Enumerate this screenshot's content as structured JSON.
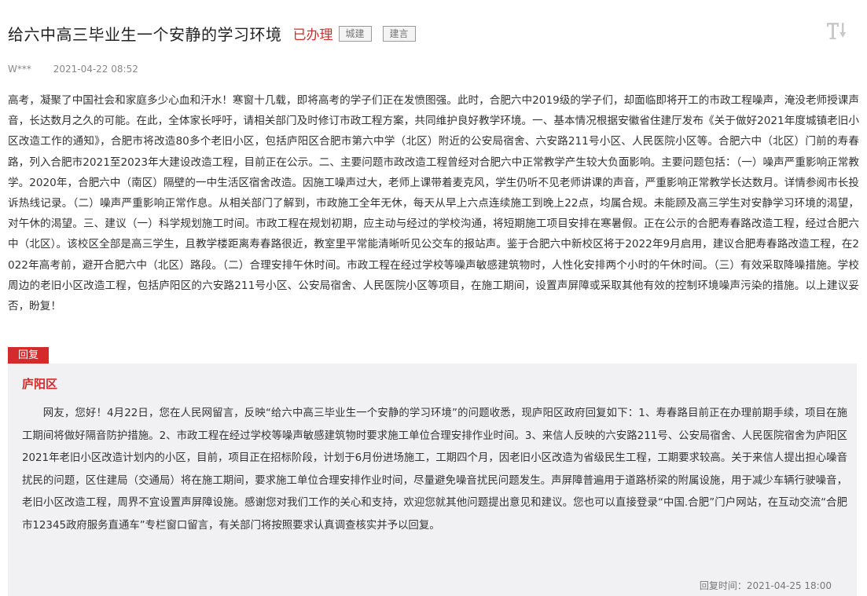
{
  "header": {
    "title": "给六中高三毕业生一个安静的学习环境",
    "status": "已办理",
    "tags": [
      "城建",
      "建言"
    ],
    "font_size_icon": "text-size-icon"
  },
  "meta": {
    "author": "W***",
    "date": "2021-04-22 08:52"
  },
  "body": {
    "text": "高考，凝聚了中国社会和家庭多少心血和汗水！寒窗十几载，即将高考的学子们正在发愤图强。此时，合肥六中2019级的学子们，却面临即将开工的市政工程噪声，淹没老师授课声音，长达数月之久的可能。在此，全体家长呼吁，请相关部门及时修订市政工程方案，共同维护良好教学环境。一、基本情况根据安徽省住建厅发布《关于做好2021年度城镇老旧小区改造工作的通知》，合肥市将改造80多个老旧小区，包括庐阳区合肥市第六中学（北区）附近的公安局宿舍、六安路211号小区、人民医院小区等。合肥六中（北区）门前的寿春路，列入合肥市2021至2023年大建设改造工程，目前正在公示。二、主要问题市政改造工程曾经对合肥六中正常教学产生较大负面影响。主要问题包括：（一）噪声严重影响正常教学。2020年，合肥六中（南区）隔壁的一中生活区宿舍改造。因施工噪声过大，老师上课带着麦克风，学生仍听不见老师讲课的声音，严重影响正常教学长达数月。详情参阅市长投诉热线记录。（二）噪声严重影响正常作息。从相关部门了解到，市政施工全年无休，每天从早上六点连续施工到晚上22点，均属合规。未能顾及高三学生对安静学习环境的渴望，对午休的渴望。三、建议（一）科学规划施工时间。市政工程在规划初期，应主动与经过的学校沟通，将短期施工项目安排在寒暑假。正在公示的合肥寿春路改造工程，经过合肥六中（北区）。该校区全部是高三学生，且教学楼距离寿春路很近，教室里平常能清晰听见公交车的报站声。鉴于合肥六中新校区将于2022年9月启用，建议合肥寿春路改造工程，在2022年高考前，避开合肥六中（北区）路段。（二）合理安排午休时间。市政工程在经过学校等噪声敏感建筑物时，人性化安排两个小时的午休时间。（三）有效采取降噪措施。学校周边的老旧小区改造工程，包括庐阳区的六安路211号小区、公安局宿舍、人民医院小区等项目，在施工期间，设置声屏障或采取其他有效的控制环境噪声污染的措施。以上建议妥否，盼复！"
  },
  "reply": {
    "badge": "回复",
    "org": "庐阳区",
    "text": "网友，您好！4月22日，您在人民网留言，反映“给六中高三毕业生一个安静的学习环境”的问题收悉，现庐阳区政府回复如下：1、寿春路目前正在办理前期手续，项目在施工期间将做好隔音防护措施。2、市政工程在经过学校等噪声敏感建筑物时要求施工单位合理安排作业时间。3、来信人反映的六安路211号、公安局宿舍、人民医院宿舍为庐阳区2021年老旧小区改造计划内的小区，目前，项目正在招标阶段，计划于6月份进场施工，工期四个月，因老旧小区改造为省级民生工程，工期要求较高。关于来信人提出担心噪音扰民的问题，区住建局（交通局）将在施工期间，要求施工单位合理安排作业时间，尽量避免噪音扰民问题发生。声屏障普遍用于道路桥梁的附属设施，用于减少车辆行驶噪音，老旧小区改造工程，周界不宜设置声屏障设施。感谢您对我们工作的关心和支持，欢迎您就其他问题提出意见和建议。您也可以直接登录“中国.合肥”门户网站，在互动交流“合肥市12345政府服务直通车”专栏窗口留言，有关部门将按照要求认真调查核实并予以回复。",
    "time": "回复时间：2021-04-25 18:00"
  },
  "colors": {
    "accent": "#d42a2a",
    "reply_bg": "#f1f1f4"
  }
}
